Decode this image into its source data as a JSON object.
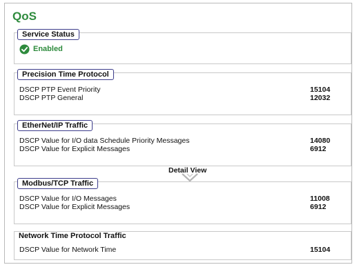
{
  "page": {
    "title": "QoS"
  },
  "service_status": {
    "title": "Service Status",
    "status_text": "Enabled",
    "status_icon": "check-circle-icon",
    "status_color": "#2e8b3d"
  },
  "ptp": {
    "title": "Precision Time Protocol",
    "rows": [
      {
        "label": "DSCP PTP Event Priority",
        "value": "15104"
      },
      {
        "label": "DSCP PTP General",
        "value": "12032"
      }
    ]
  },
  "ethernet_ip": {
    "title": "EtherNet/IP Traffic",
    "rows": [
      {
        "label": "DSCP Value for I/O data Schedule Priority Messages",
        "value": "14080"
      },
      {
        "label": "DSCP Value for Explicit Messages",
        "value": "6912"
      }
    ]
  },
  "detail_view": {
    "label": "Detail View",
    "icon": "chevron-down-icon"
  },
  "modbus_tcp": {
    "title": "Modbus/TCP Traffic",
    "rows": [
      {
        "label": "DSCP Value for I/O Messages",
        "value": "11008"
      },
      {
        "label": "DSCP Value for Explicit Messages",
        "value": "6912"
      }
    ]
  },
  "ntp": {
    "title": "Network Time Protocol Traffic",
    "rows": [
      {
        "label": "DSCP Value for Network Time",
        "value": "15104"
      }
    ]
  }
}
